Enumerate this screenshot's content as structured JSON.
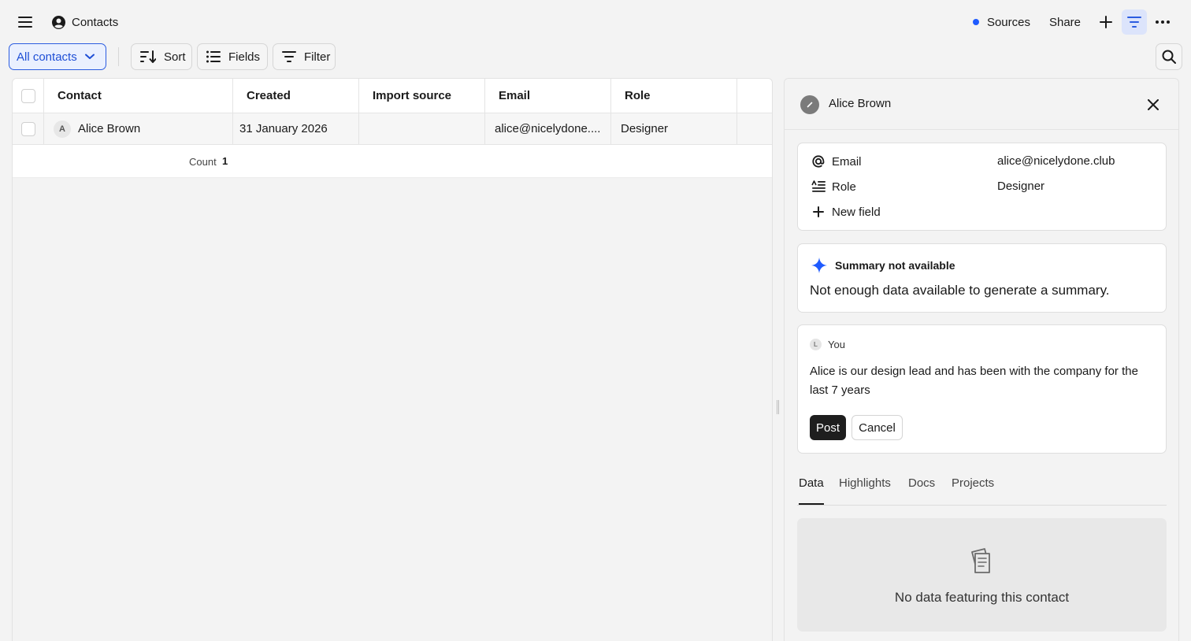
{
  "app": {
    "title": "Contacts"
  },
  "header": {
    "sources_label": "Sources",
    "share_label": "Share"
  },
  "toolbar": {
    "view_label": "All contacts",
    "sort_label": "Sort",
    "fields_label": "Fields",
    "filter_label": "Filter"
  },
  "table": {
    "columns": [
      "Contact",
      "Created",
      "Import source",
      "Email",
      "Role"
    ],
    "rows": [
      {
        "avatar": "A",
        "contact": "Alice Brown",
        "created": "31 January 2026",
        "import_source": "",
        "email": "alice@nicelydone....",
        "role": "Designer"
      }
    ],
    "count_label": "Count",
    "count_value": "1"
  },
  "detail": {
    "name": "Alice Brown",
    "fields": [
      {
        "label": "Email",
        "value": "alice@nicelydone.club",
        "icon": "at-icon"
      },
      {
        "label": "Role",
        "value": "Designer",
        "icon": "text-align-icon"
      }
    ],
    "new_field_label": "New field",
    "summary": {
      "title": "Summary not available",
      "body": "Not enough data available to generate a summary."
    },
    "note": {
      "avatar": "L",
      "author": "You",
      "text": "Alice is our design lead and has been with the company for the last 7 years",
      "post_label": "Post",
      "cancel_label": "Cancel"
    },
    "tabs": [
      "Data",
      "Highlights",
      "Docs",
      "Projects"
    ],
    "active_tab": "Data",
    "empty_text": "No data featuring this contact"
  },
  "colors": {
    "accent": "#1f5bff",
    "accent_bg": "#eaf0fe",
    "primary_button": "#1e1e1e"
  }
}
